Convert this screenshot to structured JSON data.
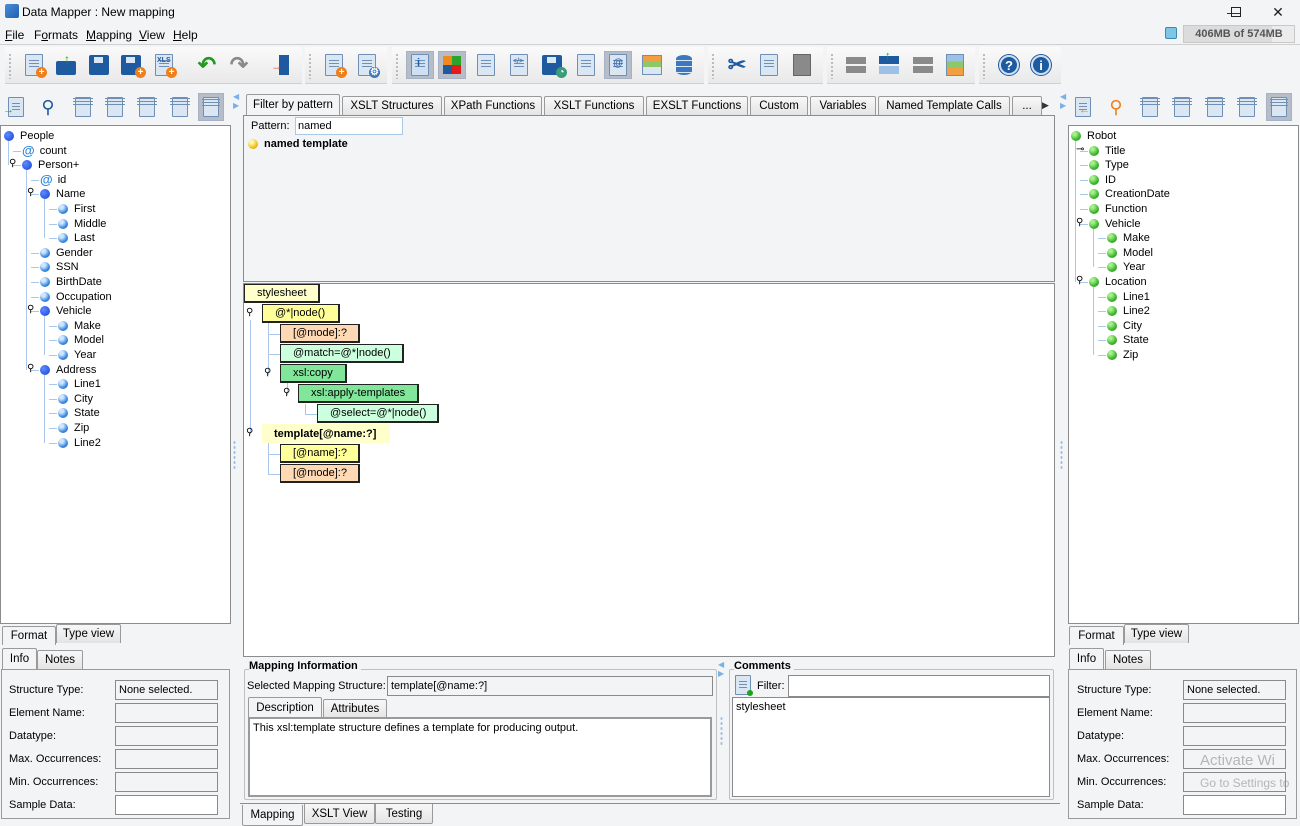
{
  "window": {
    "title": "Data Mapper : New mapping",
    "minimize": "—",
    "maximize": "☐",
    "close": "✕"
  },
  "menu": {
    "items": [
      {
        "label": "File",
        "mnemonic": "F"
      },
      {
        "label": "Formats",
        "mnemonic": "o"
      },
      {
        "label": "Mapping",
        "mnemonic": "M"
      },
      {
        "label": "View",
        "mnemonic": "V"
      },
      {
        "label": "Help",
        "mnemonic": "H"
      }
    ]
  },
  "memory": {
    "label": "406MB of 574MB",
    "used_fraction": 0.71
  },
  "toolbar": {
    "groups": [
      [
        "new-mapping",
        "open",
        "save",
        "save-as",
        "new-xls",
        "undo",
        "redo",
        "exit"
      ],
      [
        "add-format",
        "format-settings"
      ],
      [
        "view-info",
        "view-colors",
        "checklist",
        "xslt-code",
        "save-snapshot",
        "grid",
        "at-view",
        "table-view",
        "database"
      ],
      [
        "cut",
        "copy",
        "paste"
      ],
      [
        "move-up",
        "insert-above",
        "move-down",
        "split-layout"
      ],
      [
        "help",
        "about"
      ]
    ]
  },
  "left_panel": {
    "tree": [
      {
        "label": "People",
        "type": "element",
        "level": 0
      },
      {
        "label": "count",
        "type": "attribute",
        "level": 1
      },
      {
        "label": "Person+",
        "type": "element",
        "level": 1,
        "expanded": true
      },
      {
        "label": "id",
        "type": "attribute",
        "level": 2
      },
      {
        "label": "Name",
        "type": "element",
        "level": 2,
        "expanded": true
      },
      {
        "label": "First",
        "type": "leaf",
        "level": 3
      },
      {
        "label": "Middle",
        "type": "leaf",
        "level": 3
      },
      {
        "label": "Last",
        "type": "leaf",
        "level": 3
      },
      {
        "label": "Gender",
        "type": "leaf",
        "level": 2
      },
      {
        "label": "SSN",
        "type": "leaf",
        "level": 2
      },
      {
        "label": "BirthDate",
        "type": "leaf",
        "level": 2
      },
      {
        "label": "Occupation",
        "type": "leaf",
        "level": 2
      },
      {
        "label": "Vehicle",
        "type": "element",
        "level": 2,
        "expanded": true
      },
      {
        "label": "Make",
        "type": "leaf",
        "level": 3
      },
      {
        "label": "Model",
        "type": "leaf",
        "level": 3
      },
      {
        "label": "Year",
        "type": "leaf",
        "level": 3
      },
      {
        "label": "Address",
        "type": "element",
        "level": 2,
        "expanded": true
      },
      {
        "label": "Line1",
        "type": "leaf",
        "level": 3
      },
      {
        "label": "City",
        "type": "leaf",
        "level": 3
      },
      {
        "label": "State",
        "type": "leaf",
        "level": 3
      },
      {
        "label": "Zip",
        "type": "leaf",
        "level": 3
      },
      {
        "label": "Line2",
        "type": "leaf",
        "level": 3
      }
    ],
    "view_tabs": [
      "Format",
      "Type view"
    ],
    "info_tabs": [
      "Info",
      "Notes"
    ],
    "info": {
      "structure_type_label": "Structure Type:",
      "structure_type_value": "None selected.",
      "element_name_label": "Element Name:",
      "element_name_value": "",
      "datatype_label": "Datatype:",
      "datatype_value": "",
      "max_occ_label": "Max. Occurrences:",
      "max_occ_value": "",
      "min_occ_label": "Min. Occurrences:",
      "min_occ_value": "",
      "sample_label": "Sample Data:",
      "sample_value": ""
    }
  },
  "right_panel": {
    "tree": [
      {
        "label": "Robot",
        "level": 0
      },
      {
        "label": "Title",
        "level": 1,
        "expander": "collapsed"
      },
      {
        "label": "Type",
        "level": 1
      },
      {
        "label": "ID",
        "level": 1
      },
      {
        "label": "CreationDate",
        "level": 1
      },
      {
        "label": "Function",
        "level": 1
      },
      {
        "label": "Vehicle",
        "level": 1,
        "expander": "expanded"
      },
      {
        "label": "Make",
        "level": 2
      },
      {
        "label": "Model",
        "level": 2
      },
      {
        "label": "Year",
        "level": 2
      },
      {
        "label": "Location",
        "level": 1,
        "expander": "expanded"
      },
      {
        "label": "Line1",
        "level": 2
      },
      {
        "label": "Line2",
        "level": 2
      },
      {
        "label": "City",
        "level": 2
      },
      {
        "label": "State",
        "level": 2
      },
      {
        "label": "Zip",
        "level": 2
      }
    ],
    "view_tabs": [
      "Format",
      "Type view"
    ],
    "info_tabs": [
      "Info",
      "Notes"
    ],
    "info": {
      "structure_type_label": "Structure Type:",
      "structure_type_value": "None selected.",
      "element_name_label": "Element Name:",
      "datatype_label": "Datatype:",
      "max_occ_label": "Max. Occurrences:",
      "min_occ_label": "Min. Occurrences:",
      "sample_label": "Sample Data:"
    },
    "watermark_line1": "Activate Wi",
    "watermark_line2": "Go to Settings to"
  },
  "palette": {
    "tabs": [
      "Filter by pattern",
      "XSLT Structures",
      "XPath Functions",
      "XSLT Functions",
      "EXSLT Functions",
      "Custom",
      "Variables",
      "Named Template Calls",
      "..."
    ],
    "active_tab": "Filter by pattern",
    "pattern_label": "Pattern:",
    "pattern_value": "named",
    "results": [
      {
        "label": "named template"
      }
    ]
  },
  "mapping": {
    "blocks": [
      {
        "label": "stylesheet",
        "style": "ly"
      },
      {
        "label": "@*|node()",
        "style": "y"
      },
      {
        "label": "[@mode]:?",
        "style": "pe"
      },
      {
        "label": "@match=@*|node()",
        "style": "mg"
      },
      {
        "label": "xsl:copy",
        "style": "g"
      },
      {
        "label": "xsl:apply-templates",
        "style": "g"
      },
      {
        "label": "@select=@*|node()",
        "style": "mg"
      },
      {
        "label": "template[@name:?]",
        "style": "ly",
        "selected": true
      },
      {
        "label": "[@name]:?",
        "style": "y"
      },
      {
        "label": "[@mode]:?",
        "style": "pe"
      }
    ]
  },
  "mapping_info": {
    "legend": "Mapping Information",
    "selected_label": "Selected Mapping Structure:",
    "selected_value": "template[@name:?]",
    "tabs": [
      "Description",
      "Attributes"
    ],
    "description": "This xsl:template structure defines a template for producing output."
  },
  "comments": {
    "legend": "Comments",
    "filter_label": "Filter:",
    "filter_value": "",
    "items": [
      "stylesheet"
    ]
  },
  "bottom_tabs": [
    "Mapping",
    "XSLT View",
    "Testing"
  ],
  "active_bottom_tab": "Mapping"
}
